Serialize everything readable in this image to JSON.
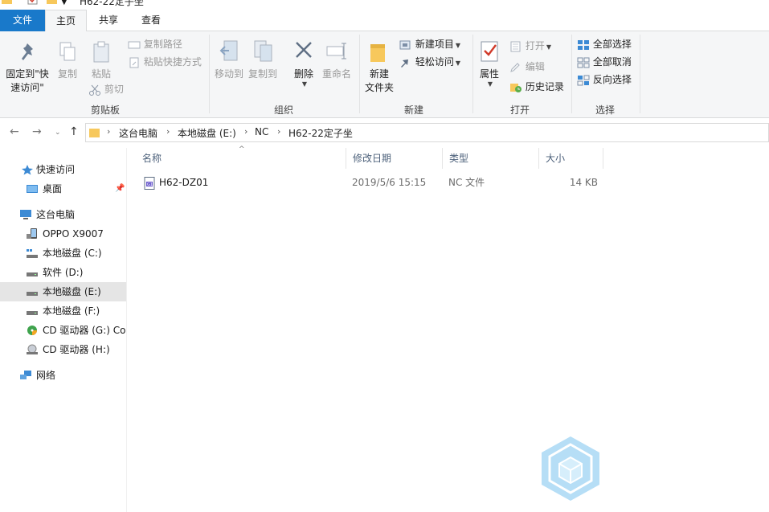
{
  "window": {
    "title": "H62-22定子坐"
  },
  "tabs": [
    {
      "label": "文件"
    },
    {
      "label": "主页"
    },
    {
      "label": "共享"
    },
    {
      "label": "查看"
    }
  ],
  "ribbon": {
    "clipboard": {
      "group_label": "剪贴板",
      "pin_label_1": "固定到\"快",
      "pin_label_2": "速访问\"",
      "copy_label": "复制",
      "paste_label": "粘贴",
      "copy_path_label": "复制路径",
      "paste_shortcut_label": "粘贴快捷方式",
      "cut_label": "剪切"
    },
    "organize": {
      "group_label": "组织",
      "move_to_label": "移动到",
      "copy_to_label": "复制到",
      "delete_label": "删除",
      "rename_label": "重命名"
    },
    "new": {
      "group_label": "新建",
      "new_folder_label_1": "新建",
      "new_folder_label_2": "文件夹",
      "new_item_label": "新建项目",
      "easy_access_label": "轻松访问"
    },
    "open": {
      "group_label": "打开",
      "properties_label": "属性",
      "open_label": "打开",
      "edit_label": "编辑",
      "history_label": "历史记录"
    },
    "select": {
      "group_label": "选择",
      "select_all_label": "全部选择",
      "select_none_label": "全部取消",
      "invert_label": "反向选择"
    }
  },
  "breadcrumb": [
    "这台电脑",
    "本地磁盘 (E:)",
    "NC",
    "H62-22定子坐"
  ],
  "sidebar": {
    "items": [
      {
        "label": "快速访问"
      },
      {
        "label": "桌面"
      },
      {
        "label": "这台电脑"
      },
      {
        "label": "OPPO X9007"
      },
      {
        "label": "本地磁盘 (C:)"
      },
      {
        "label": "软件 (D:)"
      },
      {
        "label": "本地磁盘 (E:)"
      },
      {
        "label": "本地磁盘 (F:)"
      },
      {
        "label": "CD 驱动器 (G:) Col"
      },
      {
        "label": "CD 驱动器 (H:)"
      },
      {
        "label": "网络"
      }
    ]
  },
  "filelist": {
    "columns": [
      "名称",
      "修改日期",
      "类型",
      "大小"
    ],
    "rows": [
      {
        "name": "H62-DZ01",
        "date": "2019/5/6 15:15",
        "type": "NC 文件",
        "size": "14 KB"
      }
    ]
  },
  "colors": {
    "accent": "#1979ca",
    "selection": "#e5e5e5",
    "header_text": "#4c607a",
    "folder": "#f7c85c"
  }
}
